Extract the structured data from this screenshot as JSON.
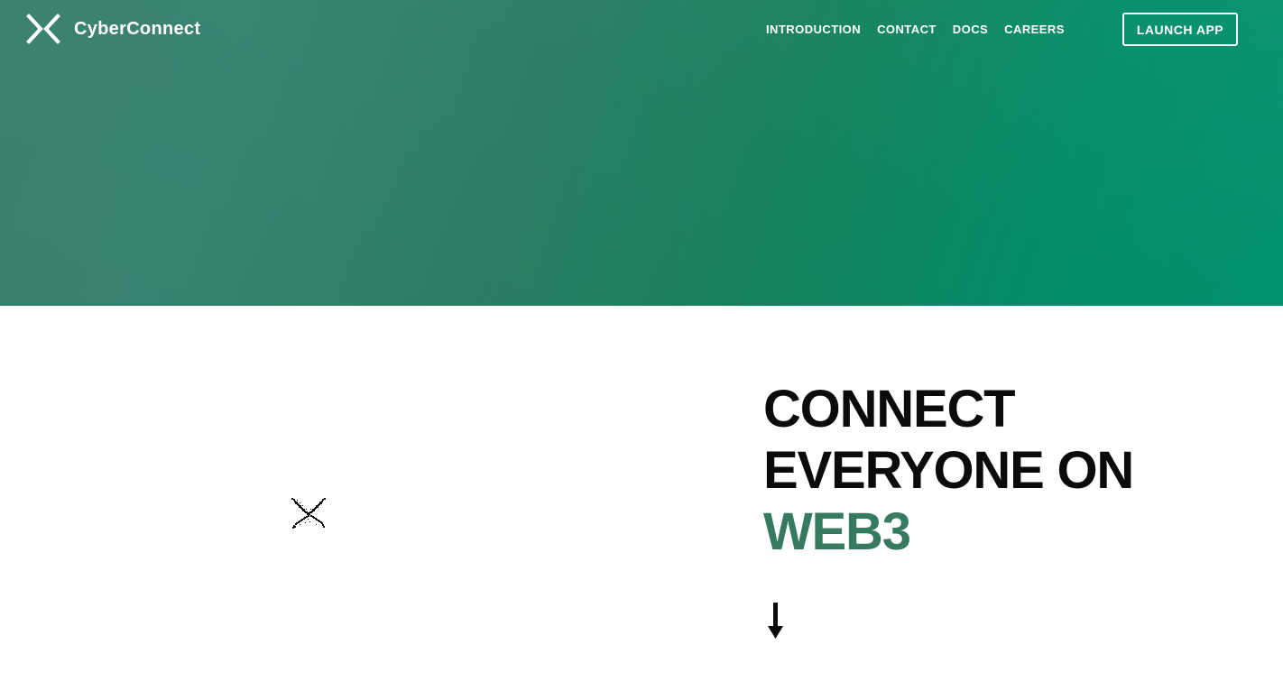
{
  "site": {
    "brand_name": "CyberConnect",
    "brand_mark_icon": "cyberconnect-chevron-x-logo"
  },
  "nav": {
    "items": [
      {
        "label": "INTRODUCTION"
      },
      {
        "label": "CONTACT"
      },
      {
        "label": "DOCS"
      },
      {
        "label": "CAREERS"
      }
    ],
    "cta_label": "LAUNCH APP"
  },
  "hero": {
    "headline_line1": "CONNECT",
    "headline_line2": "EVERYONE ON",
    "headline_line3": "WEB3",
    "scroll_icon": "arrow-down-icon",
    "decor_icon": "cyberconnect-x-sprite"
  },
  "colors": {
    "gradient_start": "#3d8270",
    "gradient_end": "#00926d",
    "accent_green": "#367a5f",
    "headline_black": "#0b0b0b",
    "nav_text": "#ffffff",
    "page_background": "#ffffff"
  }
}
